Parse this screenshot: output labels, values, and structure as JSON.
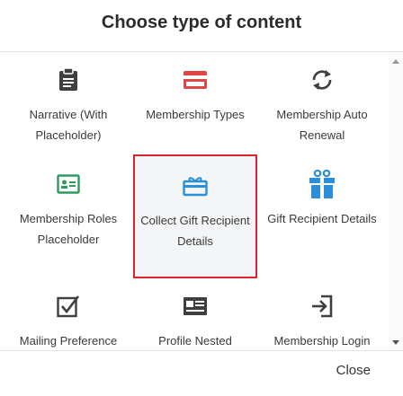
{
  "dialog": {
    "title": "Choose type of content",
    "close_label": "Close"
  },
  "tiles": [
    {
      "label": "Narrative (With Placeholder)",
      "icon": "clipboard-icon",
      "color": "#3f3f3f"
    },
    {
      "label": "Membership Types",
      "icon": "card-icon",
      "color": "#e04646"
    },
    {
      "label": "Membership Auto Renewal",
      "icon": "sync-icon",
      "color": "#3f3f3f"
    },
    {
      "label": "Membership Roles Placeholder",
      "icon": "id-card-icon",
      "color": "#2e9b5e"
    },
    {
      "label": "Collect Gift Recipient Details",
      "icon": "gift-card-icon",
      "color": "#2a8fd8",
      "selected": true
    },
    {
      "label": "Gift Recipient Details",
      "icon": "gift-icon",
      "color": "#2a8fd8"
    },
    {
      "label": "Mailing Preference",
      "icon": "checkbox-icon",
      "color": "#3f3f3f"
    },
    {
      "label": "Profile Nested",
      "icon": "profile-card-icon",
      "color": "#3f3f3f"
    },
    {
      "label": "Membership Login",
      "icon": "sign-in-icon",
      "color": "#3f3f3f"
    }
  ]
}
